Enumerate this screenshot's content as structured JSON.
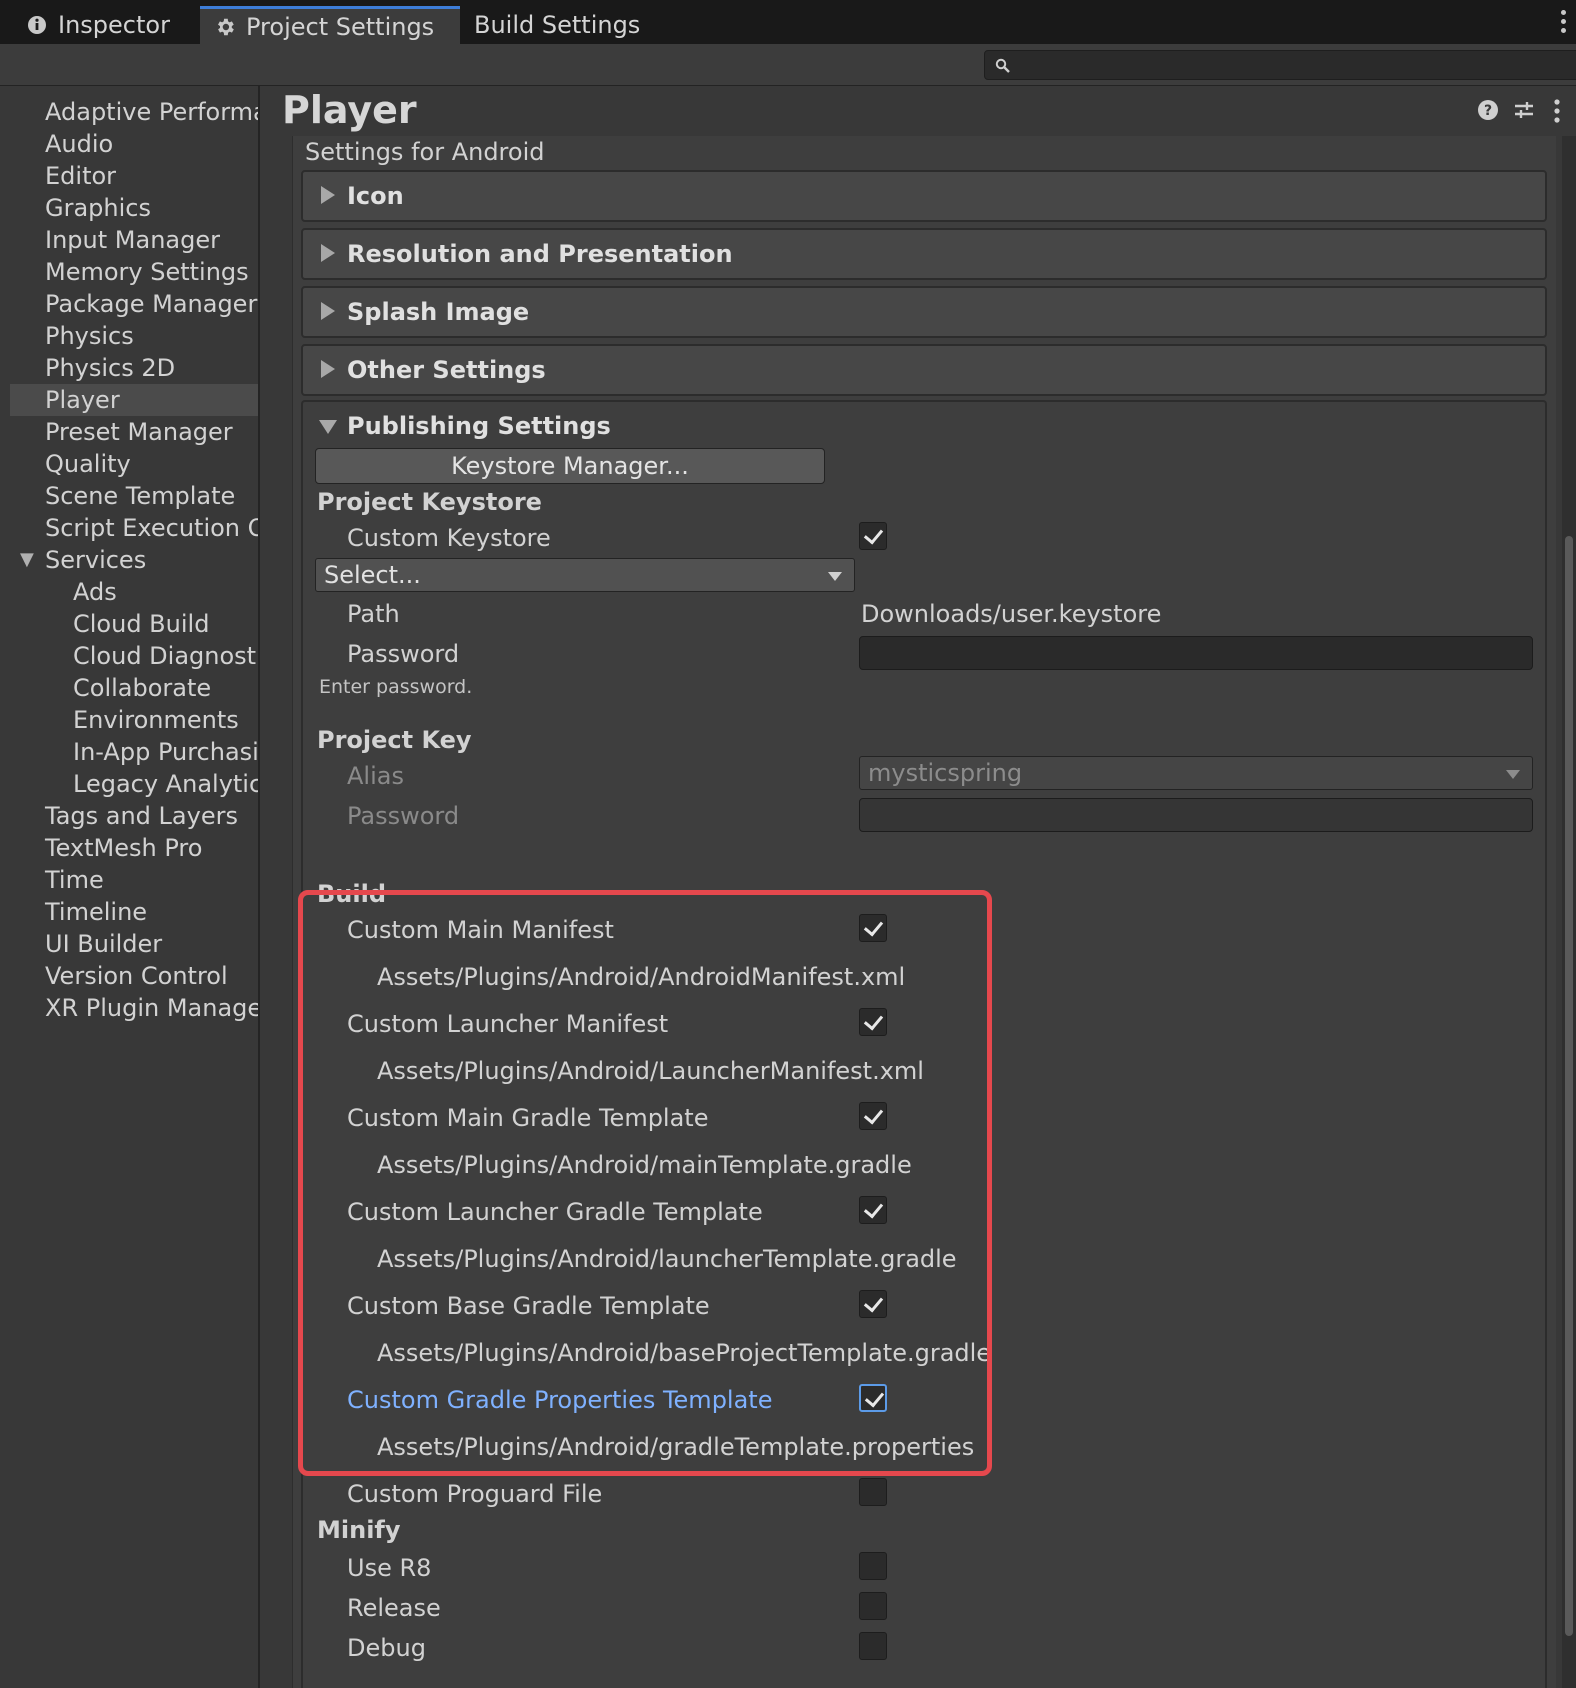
{
  "tabs": [
    {
      "label": "Inspector",
      "icon": "info-icon"
    },
    {
      "label": "Project Settings",
      "icon": "gear-icon"
    },
    {
      "label": "Build Settings"
    }
  ],
  "search": {
    "placeholder": "",
    "icon": "search-icon"
  },
  "sidebar": {
    "items": [
      {
        "label": "Adaptive Performar"
      },
      {
        "label": "Audio"
      },
      {
        "label": "Editor"
      },
      {
        "label": "Graphics"
      },
      {
        "label": "Input Manager"
      },
      {
        "label": "Memory Settings"
      },
      {
        "label": "Package Manager"
      },
      {
        "label": "Physics"
      },
      {
        "label": "Physics 2D"
      },
      {
        "label": "Player",
        "selected": true
      },
      {
        "label": "Preset Manager"
      },
      {
        "label": "Quality"
      },
      {
        "label": "Scene Template"
      },
      {
        "label": "Script Execution Or"
      },
      {
        "label": "Services",
        "expanded": true
      },
      {
        "label": "Ads",
        "child": true
      },
      {
        "label": "Cloud Build",
        "child": true
      },
      {
        "label": "Cloud Diagnostic",
        "child": true
      },
      {
        "label": "Collaborate",
        "child": true
      },
      {
        "label": "Environments",
        "child": true
      },
      {
        "label": "In-App Purchasir",
        "child": true
      },
      {
        "label": "Legacy Analytic:",
        "child": true
      },
      {
        "label": "Tags and Layers"
      },
      {
        "label": "TextMesh Pro"
      },
      {
        "label": "Time"
      },
      {
        "label": "Timeline"
      },
      {
        "label": "UI Builder"
      },
      {
        "label": "Version Control"
      },
      {
        "label": "XR Plugin Manager"
      }
    ]
  },
  "main": {
    "title": "Player",
    "subtitle": "Settings for Android",
    "header_icons": [
      "help-icon",
      "preset-icon",
      "kebab-icon"
    ],
    "foldouts": [
      {
        "label": "Icon"
      },
      {
        "label": "Resolution and Presentation"
      },
      {
        "label": "Splash Image"
      },
      {
        "label": "Other Settings"
      }
    ],
    "publishing": {
      "label": "Publishing Settings",
      "keystore_button": "Keystore Manager...",
      "project_keystore": {
        "heading": "Project Keystore",
        "custom_keystore_label": "Custom Keystore",
        "custom_keystore_checked": true,
        "select_value": "Select...",
        "path_label": "Path",
        "path_value": "Downloads/user.keystore",
        "password_label": "Password",
        "password_hint": "Enter password."
      },
      "project_key": {
        "heading": "Project Key",
        "alias_label": "Alias",
        "alias_value": "mysticspring",
        "password_label": "Password"
      },
      "build": {
        "heading": "Build",
        "rows": [
          {
            "label": "Custom Main Manifest",
            "checked": true,
            "path": "Assets/Plugins/Android/AndroidManifest.xml"
          },
          {
            "label": "Custom Launcher Manifest",
            "checked": true,
            "path": "Assets/Plugins/Android/LauncherManifest.xml"
          },
          {
            "label": "Custom Main Gradle Template",
            "checked": true,
            "path": "Assets/Plugins/Android/mainTemplate.gradle"
          },
          {
            "label": "Custom Launcher Gradle Template",
            "checked": true,
            "path": "Assets/Plugins/Android/launcherTemplate.gradle"
          },
          {
            "label": "Custom Base Gradle Template",
            "checked": true,
            "path": "Assets/Plugins/Android/baseProjectTemplate.gradle"
          },
          {
            "label": "Custom Gradle Properties Template",
            "checked": true,
            "path": "Assets/Plugins/Android/gradleTemplate.properties"
          }
        ],
        "proguard_label": "Custom Proguard File",
        "proguard_checked": false
      },
      "minify": {
        "heading": "Minify",
        "use_r8_label": "Use R8",
        "release_label": "Release",
        "debug_label": "Debug"
      }
    }
  },
  "colors": {
    "accent": "#3d7dd8",
    "highlight_box": "#e5484d",
    "focused_label": "#7fb1ff"
  }
}
